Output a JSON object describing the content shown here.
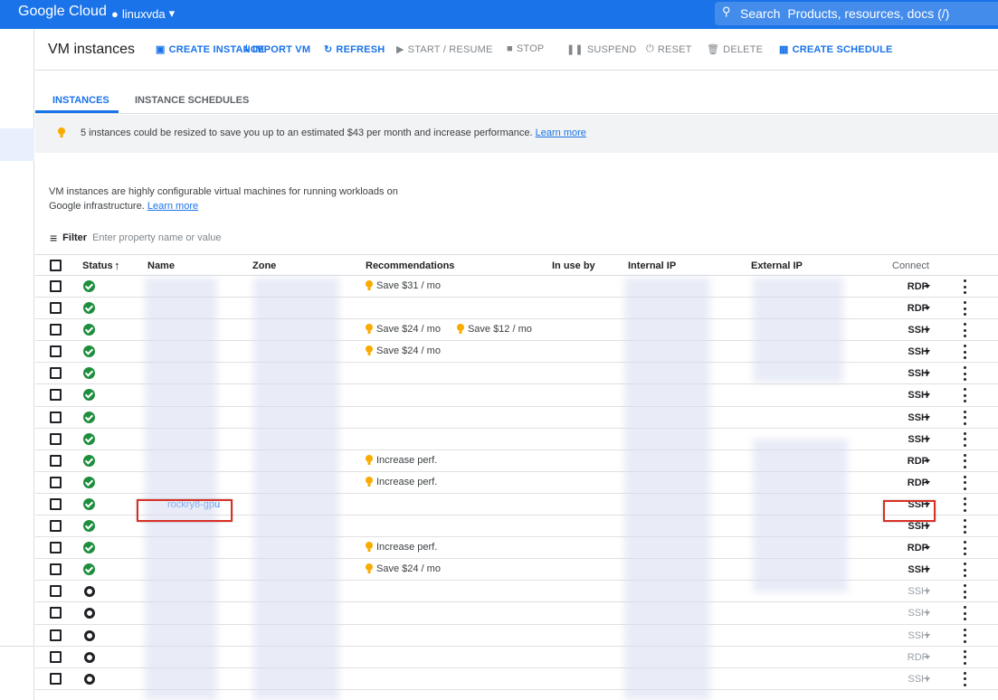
{
  "topbar": {
    "brand": "Google Cloud",
    "project": "linuxvda",
    "search_label": "Search",
    "search_placeholder": "Products, resources, docs (/)"
  },
  "page_title": "VM instances",
  "actions": [
    {
      "label": "CREATE INSTANCE",
      "icon": "add-box-icon",
      "state": "primary"
    },
    {
      "label": "IMPORT VM",
      "icon": "import-icon",
      "state": "primary"
    },
    {
      "label": "REFRESH",
      "icon": "refresh-icon",
      "state": "primary"
    },
    {
      "label": "START / RESUME",
      "icon": "play-icon",
      "state": "disabled"
    },
    {
      "label": "STOP",
      "icon": "stop-icon",
      "state": "disabled"
    },
    {
      "label": "SUSPEND",
      "icon": "pause-icon",
      "state": "disabled"
    },
    {
      "label": "RESET",
      "icon": "power-icon",
      "state": "disabled"
    },
    {
      "label": "DELETE",
      "icon": "trash-icon",
      "state": "disabled"
    },
    {
      "label": "CREATE SCHEDULE",
      "icon": "calendar-icon",
      "state": "primary"
    }
  ],
  "tabs": [
    {
      "label": "INSTANCES",
      "active": true
    },
    {
      "label": "INSTANCE SCHEDULES",
      "active": false
    }
  ],
  "banner": {
    "text": "5 instances could be resized to save you up to an estimated $43 per month and increase performance.",
    "link": "Learn more"
  },
  "description": {
    "text": "VM instances are highly configurable virtual machines for running workloads on Google infrastructure.",
    "link": "Learn more"
  },
  "filter": {
    "label": "Filter",
    "placeholder": "Enter property name or value"
  },
  "columns": [
    "Status",
    "Name",
    "Zone",
    "Recommendations",
    "In use by",
    "Internal IP",
    "External IP",
    "Connect"
  ],
  "rows": [
    {
      "status": "running",
      "name": "",
      "recs": [
        "Save $31 / mo"
      ],
      "connect": "RDP",
      "enabled": true
    },
    {
      "status": "running",
      "name": "",
      "recs": [],
      "connect": "RDP",
      "enabled": true
    },
    {
      "status": "running",
      "name": "",
      "recs": [
        "Save $24 / mo",
        "Save $12 / mo"
      ],
      "connect": "SSH",
      "enabled": true
    },
    {
      "status": "running",
      "name": "",
      "recs": [
        "Save $24 / mo"
      ],
      "connect": "SSH",
      "enabled": true
    },
    {
      "status": "running",
      "name": "",
      "recs": [],
      "connect": "SSH",
      "enabled": true
    },
    {
      "status": "running",
      "name": "",
      "recs": [],
      "connect": "SSH",
      "enabled": true
    },
    {
      "status": "running",
      "name": "",
      "recs": [],
      "connect": "SSH",
      "enabled": true
    },
    {
      "status": "running",
      "name": "",
      "recs": [],
      "connect": "SSH",
      "enabled": true
    },
    {
      "status": "running",
      "name": "",
      "recs": [
        "Increase perf."
      ],
      "connect": "RDP",
      "enabled": true
    },
    {
      "status": "running",
      "name": "",
      "recs": [
        "Increase perf."
      ],
      "connect": "RDP",
      "enabled": true
    },
    {
      "status": "running",
      "name": "rockry8-gpu",
      "recs": [],
      "connect": "SSH",
      "enabled": true
    },
    {
      "status": "running",
      "name": "",
      "recs": [],
      "connect": "SSH",
      "enabled": true
    },
    {
      "status": "running",
      "name": "",
      "recs": [
        "Increase perf."
      ],
      "connect": "RDP",
      "enabled": true
    },
    {
      "status": "running",
      "name": "",
      "recs": [
        "Save $24 / mo"
      ],
      "connect": "SSH",
      "enabled": true
    },
    {
      "status": "stopped",
      "name": "",
      "recs": [],
      "connect": "SSH",
      "enabled": false
    },
    {
      "status": "stopped",
      "name": "",
      "recs": [],
      "connect": "SSH",
      "enabled": false
    },
    {
      "status": "stopped",
      "name": "",
      "recs": [],
      "connect": "SSH",
      "enabled": false
    },
    {
      "status": "stopped",
      "name": "",
      "recs": [],
      "connect": "RDP",
      "enabled": false
    },
    {
      "status": "stopped",
      "name": "",
      "recs": [],
      "connect": "SSH",
      "enabled": false
    }
  ],
  "colors": {
    "primary": "#1a73e8",
    "running": "#1e8e3e",
    "highlight": "#d93025",
    "bulb": "#f9ab00"
  }
}
